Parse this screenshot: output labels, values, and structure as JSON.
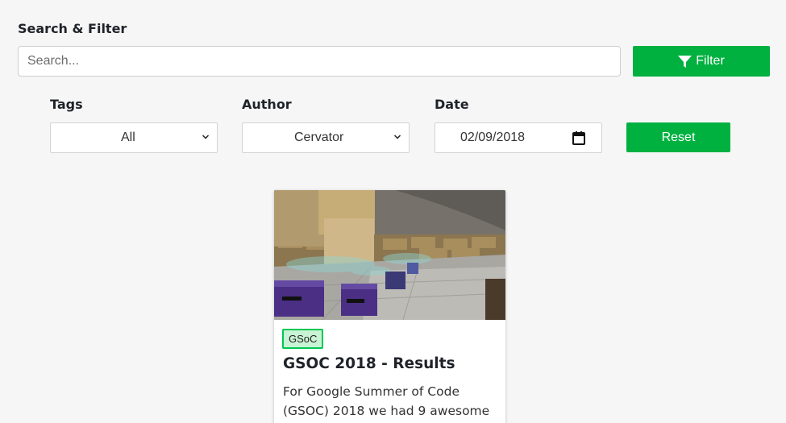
{
  "filter": {
    "section_title": "Search & Filter",
    "search_placeholder": "Search...",
    "search_value": "",
    "filter_label": "Filter",
    "tags_label": "Tags",
    "tags_value": "All",
    "author_label": "Author",
    "author_value": "Cervator",
    "date_label": "Date",
    "date_value": "02/09/2018",
    "reset_label": "Reset"
  },
  "posts": [
    {
      "tag": "GSoC",
      "title": "GSOC 2018 - Results",
      "description": "For Google Summer of Code (GSOC) 2018 we had 9 awesome"
    }
  ],
  "colors": {
    "accent": "#00b140",
    "tag_border": "#00c853",
    "tag_bg": "#c8f3d4",
    "page_bg": "#f6f6f6"
  },
  "icons": {
    "filter": "funnel-icon",
    "dropdown": "chevron-down-icon",
    "calendar": "calendar-icon"
  }
}
